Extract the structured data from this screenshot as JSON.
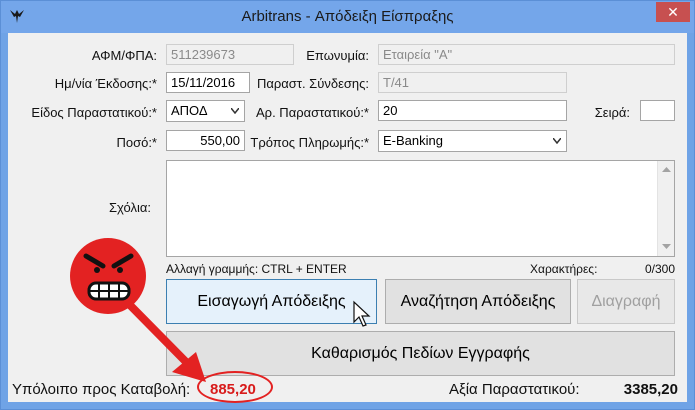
{
  "window": {
    "title": "Arbitrans - Απόδειξη Είσπραξης",
    "close": "✕"
  },
  "form": {
    "afm": {
      "label": "ΑΦΜ/ΦΠΑ:",
      "value": "511239673"
    },
    "name": {
      "label": "Επωνυμία:",
      "value": "Εταιρεία \"Α\""
    },
    "issue_date": {
      "label": "Ημ/νία Έκδοσης:*",
      "value": "15/11/2016"
    },
    "linked_doc": {
      "label": "Παραστ. Σύνδεσης:",
      "value": "Τ/41"
    },
    "doc_type": {
      "label": "Είδος Παραστατικού:*",
      "value": "ΑΠΟΔ"
    },
    "doc_number": {
      "label": "Αρ. Παραστατικού:*",
      "value": "20"
    },
    "series": {
      "label": "Σειρά:",
      "value": ""
    },
    "amount": {
      "label": "Ποσό:*",
      "value": "550,00"
    },
    "payment_method": {
      "label": "Τρόπος Πληρωμής:*",
      "value": "E-Banking"
    },
    "comments": {
      "label": "Σχόλια:",
      "value": ""
    },
    "newline_hint": "Αλλαγή γραμμής: CTRL + ENTER",
    "chars_label": "Χαρακτήρες:",
    "chars_count": "0/300"
  },
  "buttons": {
    "insert": "Εισαγωγή Απόδειξης",
    "search": "Αναζήτηση Απόδειξης",
    "delete": "Διαγραφή",
    "clear": "Καθαρισμός Πεδίων Εγγραφής"
  },
  "status": {
    "remaining_label": "Υπόλοιπο προς Καταβολή:",
    "remaining_value": "885,20",
    "total_label": "Αξία Παραστατικού:",
    "total_value": "3385,20"
  },
  "colors": {
    "titlebar": "#74a6ea",
    "close": "#c75050",
    "highlight_red": "#e32222",
    "remaining_text": "#d81b1b"
  },
  "icons": {
    "app": "eagle-icon",
    "angry": "angry-face-icon",
    "cursor": "mouse-pointer-icon"
  }
}
